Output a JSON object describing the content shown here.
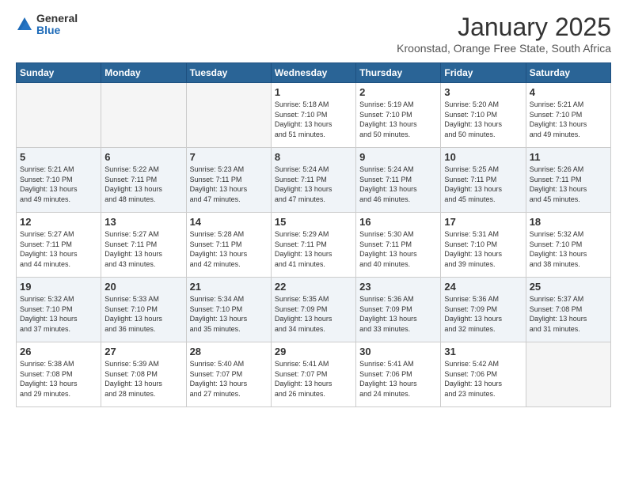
{
  "logo": {
    "general": "General",
    "blue": "Blue"
  },
  "title": "January 2025",
  "subtitle": "Kroonstad, Orange Free State, South Africa",
  "weekdays": [
    "Sunday",
    "Monday",
    "Tuesday",
    "Wednesday",
    "Thursday",
    "Friday",
    "Saturday"
  ],
  "weeks": [
    [
      {
        "day": "",
        "info": "",
        "empty": true
      },
      {
        "day": "",
        "info": "",
        "empty": true
      },
      {
        "day": "",
        "info": "",
        "empty": true
      },
      {
        "day": "1",
        "info": "Sunrise: 5:18 AM\nSunset: 7:10 PM\nDaylight: 13 hours\nand 51 minutes.",
        "empty": false
      },
      {
        "day": "2",
        "info": "Sunrise: 5:19 AM\nSunset: 7:10 PM\nDaylight: 13 hours\nand 50 minutes.",
        "empty": false
      },
      {
        "day": "3",
        "info": "Sunrise: 5:20 AM\nSunset: 7:10 PM\nDaylight: 13 hours\nand 50 minutes.",
        "empty": false
      },
      {
        "day": "4",
        "info": "Sunrise: 5:21 AM\nSunset: 7:10 PM\nDaylight: 13 hours\nand 49 minutes.",
        "empty": false
      }
    ],
    [
      {
        "day": "5",
        "info": "Sunrise: 5:21 AM\nSunset: 7:10 PM\nDaylight: 13 hours\nand 49 minutes.",
        "empty": false
      },
      {
        "day": "6",
        "info": "Sunrise: 5:22 AM\nSunset: 7:11 PM\nDaylight: 13 hours\nand 48 minutes.",
        "empty": false
      },
      {
        "day": "7",
        "info": "Sunrise: 5:23 AM\nSunset: 7:11 PM\nDaylight: 13 hours\nand 47 minutes.",
        "empty": false
      },
      {
        "day": "8",
        "info": "Sunrise: 5:24 AM\nSunset: 7:11 PM\nDaylight: 13 hours\nand 47 minutes.",
        "empty": false
      },
      {
        "day": "9",
        "info": "Sunrise: 5:24 AM\nSunset: 7:11 PM\nDaylight: 13 hours\nand 46 minutes.",
        "empty": false
      },
      {
        "day": "10",
        "info": "Sunrise: 5:25 AM\nSunset: 7:11 PM\nDaylight: 13 hours\nand 45 minutes.",
        "empty": false
      },
      {
        "day": "11",
        "info": "Sunrise: 5:26 AM\nSunset: 7:11 PM\nDaylight: 13 hours\nand 45 minutes.",
        "empty": false
      }
    ],
    [
      {
        "day": "12",
        "info": "Sunrise: 5:27 AM\nSunset: 7:11 PM\nDaylight: 13 hours\nand 44 minutes.",
        "empty": false
      },
      {
        "day": "13",
        "info": "Sunrise: 5:27 AM\nSunset: 7:11 PM\nDaylight: 13 hours\nand 43 minutes.",
        "empty": false
      },
      {
        "day": "14",
        "info": "Sunrise: 5:28 AM\nSunset: 7:11 PM\nDaylight: 13 hours\nand 42 minutes.",
        "empty": false
      },
      {
        "day": "15",
        "info": "Sunrise: 5:29 AM\nSunset: 7:11 PM\nDaylight: 13 hours\nand 41 minutes.",
        "empty": false
      },
      {
        "day": "16",
        "info": "Sunrise: 5:30 AM\nSunset: 7:11 PM\nDaylight: 13 hours\nand 40 minutes.",
        "empty": false
      },
      {
        "day": "17",
        "info": "Sunrise: 5:31 AM\nSunset: 7:10 PM\nDaylight: 13 hours\nand 39 minutes.",
        "empty": false
      },
      {
        "day": "18",
        "info": "Sunrise: 5:32 AM\nSunset: 7:10 PM\nDaylight: 13 hours\nand 38 minutes.",
        "empty": false
      }
    ],
    [
      {
        "day": "19",
        "info": "Sunrise: 5:32 AM\nSunset: 7:10 PM\nDaylight: 13 hours\nand 37 minutes.",
        "empty": false
      },
      {
        "day": "20",
        "info": "Sunrise: 5:33 AM\nSunset: 7:10 PM\nDaylight: 13 hours\nand 36 minutes.",
        "empty": false
      },
      {
        "day": "21",
        "info": "Sunrise: 5:34 AM\nSunset: 7:10 PM\nDaylight: 13 hours\nand 35 minutes.",
        "empty": false
      },
      {
        "day": "22",
        "info": "Sunrise: 5:35 AM\nSunset: 7:09 PM\nDaylight: 13 hours\nand 34 minutes.",
        "empty": false
      },
      {
        "day": "23",
        "info": "Sunrise: 5:36 AM\nSunset: 7:09 PM\nDaylight: 13 hours\nand 33 minutes.",
        "empty": false
      },
      {
        "day": "24",
        "info": "Sunrise: 5:36 AM\nSunset: 7:09 PM\nDaylight: 13 hours\nand 32 minutes.",
        "empty": false
      },
      {
        "day": "25",
        "info": "Sunrise: 5:37 AM\nSunset: 7:08 PM\nDaylight: 13 hours\nand 31 minutes.",
        "empty": false
      }
    ],
    [
      {
        "day": "26",
        "info": "Sunrise: 5:38 AM\nSunset: 7:08 PM\nDaylight: 13 hours\nand 29 minutes.",
        "empty": false
      },
      {
        "day": "27",
        "info": "Sunrise: 5:39 AM\nSunset: 7:08 PM\nDaylight: 13 hours\nand 28 minutes.",
        "empty": false
      },
      {
        "day": "28",
        "info": "Sunrise: 5:40 AM\nSunset: 7:07 PM\nDaylight: 13 hours\nand 27 minutes.",
        "empty": false
      },
      {
        "day": "29",
        "info": "Sunrise: 5:41 AM\nSunset: 7:07 PM\nDaylight: 13 hours\nand 26 minutes.",
        "empty": false
      },
      {
        "day": "30",
        "info": "Sunrise: 5:41 AM\nSunset: 7:06 PM\nDaylight: 13 hours\nand 24 minutes.",
        "empty": false
      },
      {
        "day": "31",
        "info": "Sunrise: 5:42 AM\nSunset: 7:06 PM\nDaylight: 13 hours\nand 23 minutes.",
        "empty": false
      },
      {
        "day": "",
        "info": "",
        "empty": true
      }
    ]
  ]
}
